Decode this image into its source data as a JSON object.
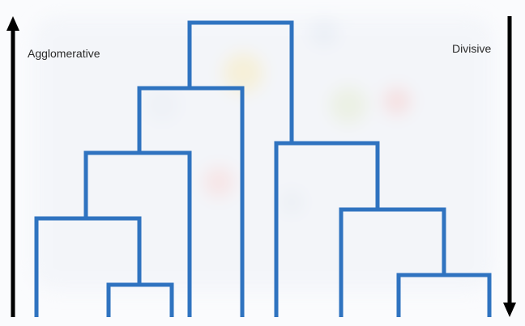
{
  "labels": {
    "agglomerative": "Agglomerative",
    "divisive": "Divisive"
  },
  "colors": {
    "dendrogram": "#2f73c0",
    "arrow": "#000000",
    "background": "#fafbfd",
    "text": "#2a2a2a"
  },
  "arrows": {
    "agglomerative": "up-arrow-icon",
    "divisive": "down-arrow-icon"
  }
}
